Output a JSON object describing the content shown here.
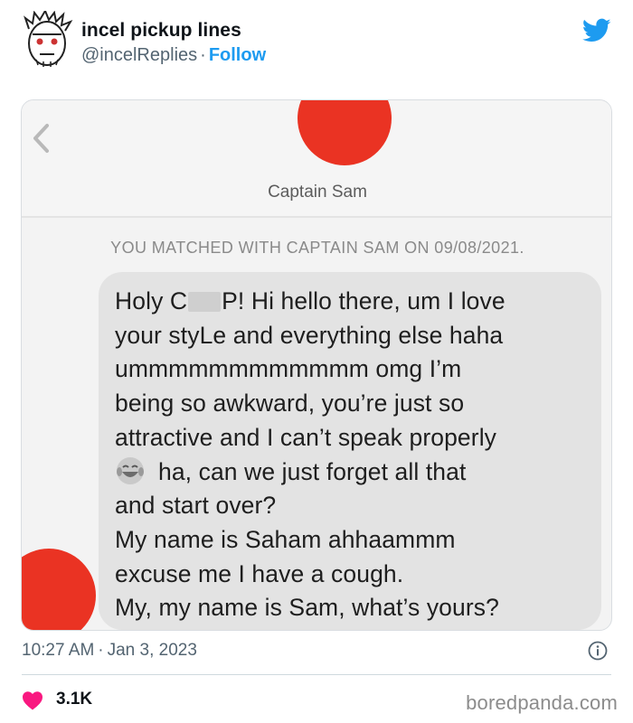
{
  "tweet": {
    "author_name": "incel pickup lines",
    "author_handle": "@incelReplies",
    "separator": "·",
    "follow_label": "Follow",
    "avatar_icon": "sketch-face-avatar-icon",
    "platform_icon": "twitter-bird-icon",
    "brand_color": "#1d9bf0",
    "timestamp_time": "10:27 AM",
    "timestamp_date": "Jan 3, 2023",
    "info_icon": "info-icon",
    "like_icon": "heart-icon",
    "like_color": "#f91880",
    "like_count": "3.1K"
  },
  "screenshot": {
    "back_icon": "chevron-left-icon",
    "match_name": "Captain Sam",
    "match_note": "YOU MATCHED WITH CAPTAIN SAM ON 09/08/2021.",
    "avatar_color": "#ea3323",
    "message_lines": {
      "line1_a": "Holy C",
      "line1_b": "P! Hi hello there, um I love",
      "line2": "your styLe and everything else haha",
      "line3": "ummmmmmmmmmmm omg I’m",
      "line4": "being so awkward, you’re just so",
      "line5": "attractive and I can’t speak properly",
      "line6": "ha, can we just forget all that",
      "line7": "and start over?",
      "line8": "My name is Saham ahhaammm",
      "line9": "excuse me I have a cough.",
      "line10": "My, my name is Sam, what’s yours?"
    },
    "emoji_icon": "laughing-tears-emoji-icon"
  },
  "watermark": "boredpanda.com"
}
